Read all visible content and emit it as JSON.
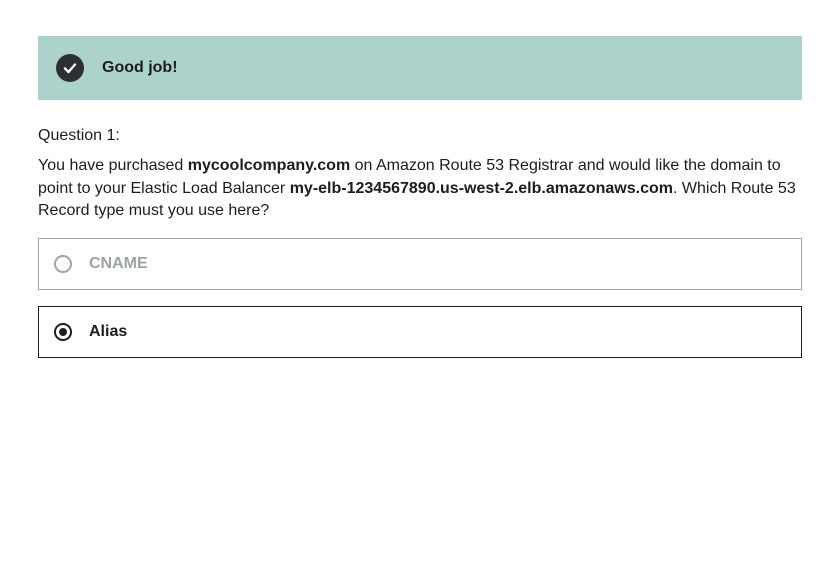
{
  "banner": {
    "icon": "check-circle-icon",
    "text": "Good job!",
    "background_color": "#acd2cc"
  },
  "question": {
    "label": "Question 1:",
    "text_parts": [
      "You have purchased ",
      "mycoolcompany.com",
      " on Amazon Route 53 Registrar and would like the domain to point to your Elastic Load Balancer ",
      "my-elb-1234567890.us-west-2.elb.amazonaws.com",
      ". Which Route 53 Record type must you use here?"
    ]
  },
  "options": [
    {
      "label": "CNAME",
      "selected": false
    },
    {
      "label": "Alias",
      "selected": true
    }
  ]
}
